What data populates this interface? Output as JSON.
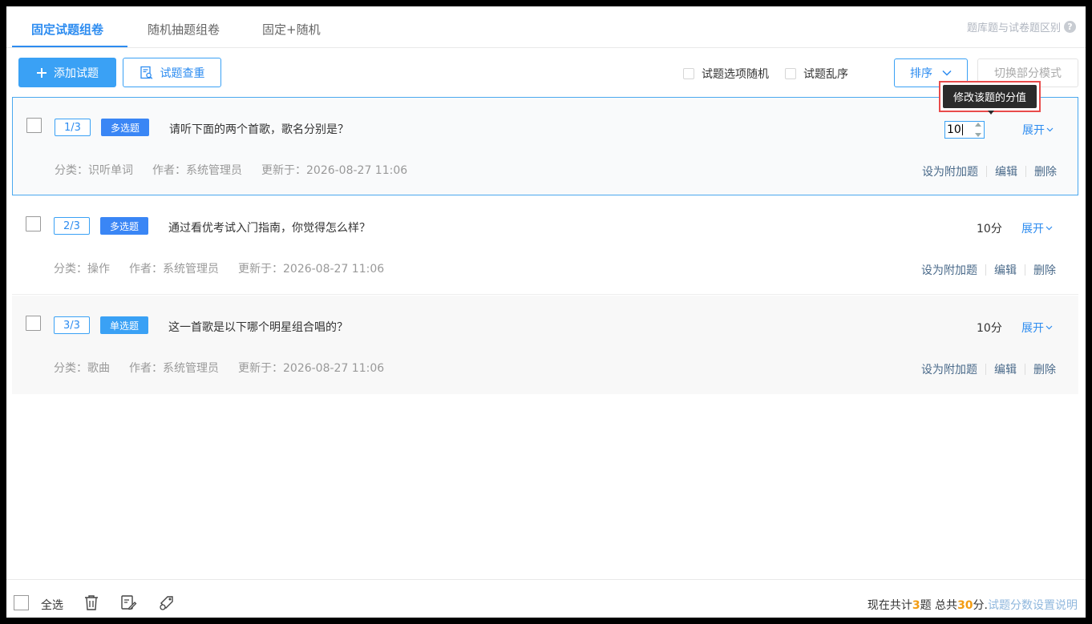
{
  "tabs": [
    {
      "label": "固定试题组卷",
      "active": true
    },
    {
      "label": "随机抽题组卷",
      "active": false
    },
    {
      "label": "固定+随机",
      "active": false
    }
  ],
  "help": {
    "label": "题库题与试卷题区别",
    "icon": "question-circle-icon"
  },
  "toolbar": {
    "add_label": "添加试题",
    "dedupe_label": "试题查重",
    "random_options_label": "试题选项随机",
    "shuffle_label": "试题乱序",
    "sort_label": "排序",
    "switch_mode_label": "切换部分模式"
  },
  "tooltip": {
    "text": "修改该题的分值"
  },
  "questions": [
    {
      "index": "1/3",
      "type": "多选题",
      "type_color": "#3a86f5",
      "text": "请听下面的两个首歌，歌名分别是？",
      "category": "分类：识听单词",
      "author": "作者：系统管理员",
      "updated": "更新于：2026-08-27 11:06",
      "score": "10",
      "score_editing": true,
      "expand": "展开",
      "actions": [
        "设为附加题",
        "编辑",
        "删除"
      ]
    },
    {
      "index": "2/3",
      "type": "多选题",
      "type_color": "#3a86f5",
      "text": "通过看优考试入门指南，你觉得怎么样？",
      "category": "分类：操作",
      "author": "作者：系统管理员",
      "updated": "更新于：2026-08-27 11:06",
      "score": "10分",
      "expand": "展开",
      "actions": [
        "设为附加题",
        "编辑",
        "删除"
      ]
    },
    {
      "index": "3/3",
      "type": "单选题",
      "type_color": "#3aa1f5",
      "text": "这一首歌是以下哪个明星组合唱的？",
      "category": "分类：歌曲",
      "author": "作者：系统管理员",
      "updated": "更新于：2026-08-27 11:06",
      "score": "10分",
      "expand": "展开",
      "actions": [
        "设为附加题",
        "编辑",
        "删除"
      ]
    }
  ],
  "footer": {
    "select_all": "全选",
    "summary_prefix": "现在共计",
    "count": "3",
    "count_unit": "题 总共",
    "total": "30",
    "total_unit": "分.",
    "help_link": "试题分数设置说明"
  }
}
